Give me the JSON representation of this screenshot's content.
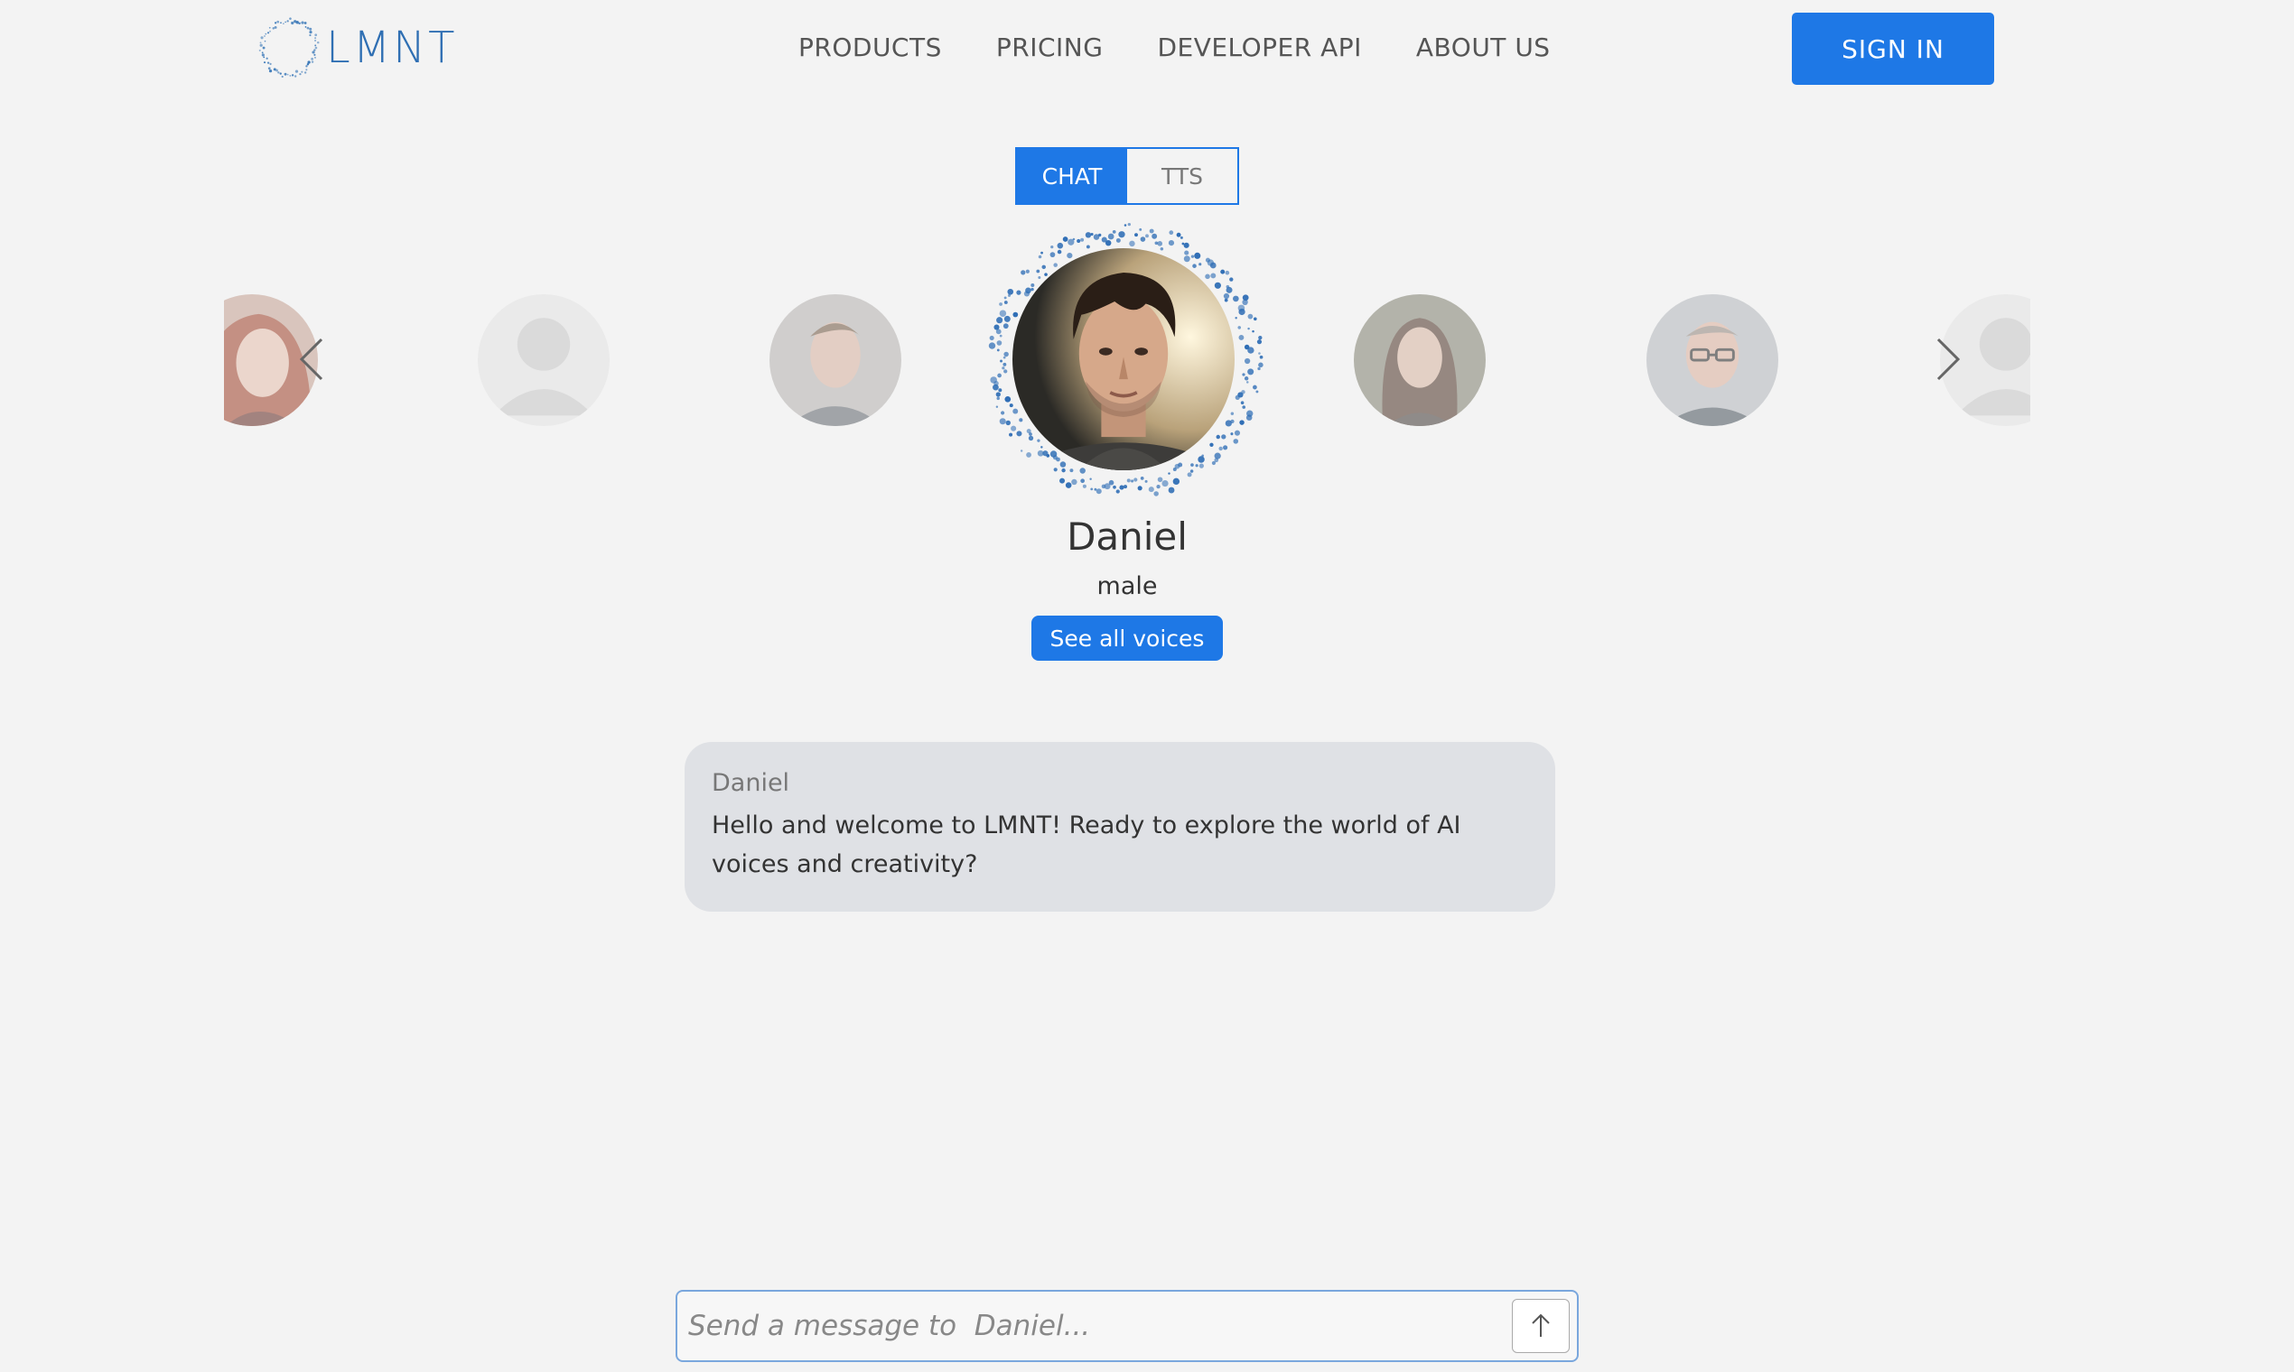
{
  "brand": {
    "name": "LMNT"
  },
  "nav": {
    "items": [
      {
        "label": "PRODUCTS"
      },
      {
        "label": "PRICING"
      },
      {
        "label": "DEVELOPER API"
      },
      {
        "label": "ABOUT US"
      }
    ],
    "signin_label": "SIGN IN"
  },
  "mode_toggle": {
    "options": [
      {
        "label": "CHAT",
        "active": true
      },
      {
        "label": "TTS",
        "active": false
      }
    ]
  },
  "carousel": {
    "voices_icons": [
      "female-portrait",
      "placeholder-avatar",
      "male-portrait",
      "daniel-portrait",
      "female-portrait",
      "male-glasses-portrait",
      "placeholder-avatar"
    ],
    "prev_icon": "chevron-left-icon",
    "next_icon": "chevron-right-icon"
  },
  "selected_voice": {
    "name": "Daniel",
    "gender": "male",
    "see_all_label": "See all voices"
  },
  "chat": {
    "messages": [
      {
        "sender": "Daniel",
        "text": "Hello and welcome to  LMNT!  Ready to explore the world of AI voices and creativity?"
      }
    ]
  },
  "composer": {
    "placeholder": "Send a message to  Daniel...",
    "send_icon": "arrow-up-icon"
  },
  "colors": {
    "accent": "#1e78e6",
    "background": "#f3f3f3",
    "bubble": "#dfe1e5",
    "brand_blue": "#2f6fb3"
  }
}
